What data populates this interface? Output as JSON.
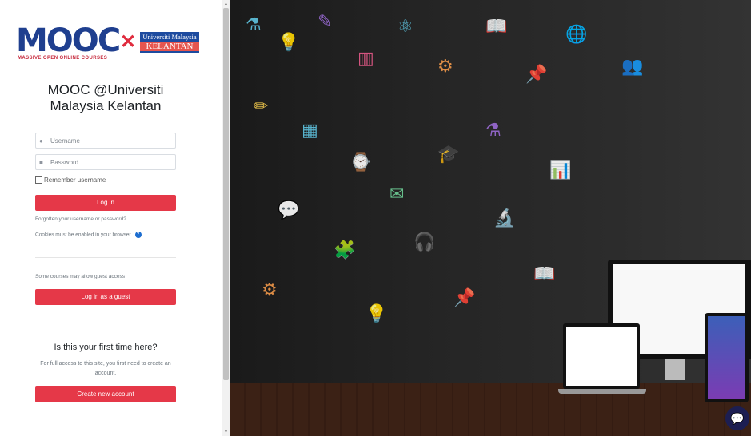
{
  "logo": {
    "brand": "MOOC",
    "tagline": "MASSIVE OPEN ONLINE COURSES",
    "university_line1": "Universiti Malaysia",
    "university_line2": "KELANTAN"
  },
  "login": {
    "site_title": "MOOC @Universiti Malaysia Kelantan",
    "username_placeholder": "Username",
    "password_placeholder": "Password",
    "remember_label": "Remember username",
    "login_button": "Log in",
    "forgot_link": "Forgotten your username or password?",
    "cookies_text": "Cookies must be enabled in your browser",
    "guest_text": "Some courses may allow guest access",
    "guest_button": "Log in as a guest",
    "first_time_heading": "Is this your first time here?",
    "first_time_desc": "For full access to this site, you first need to create an account.",
    "create_account_button": "Create new account"
  },
  "icons": {
    "user": "user-icon",
    "lock": "lock-icon",
    "help": "question-circle-icon",
    "chat": "chat-icon"
  },
  "colors": {
    "accent": "#e53848",
    "help": "#1d6ed0",
    "chat": "#1c1e52"
  }
}
